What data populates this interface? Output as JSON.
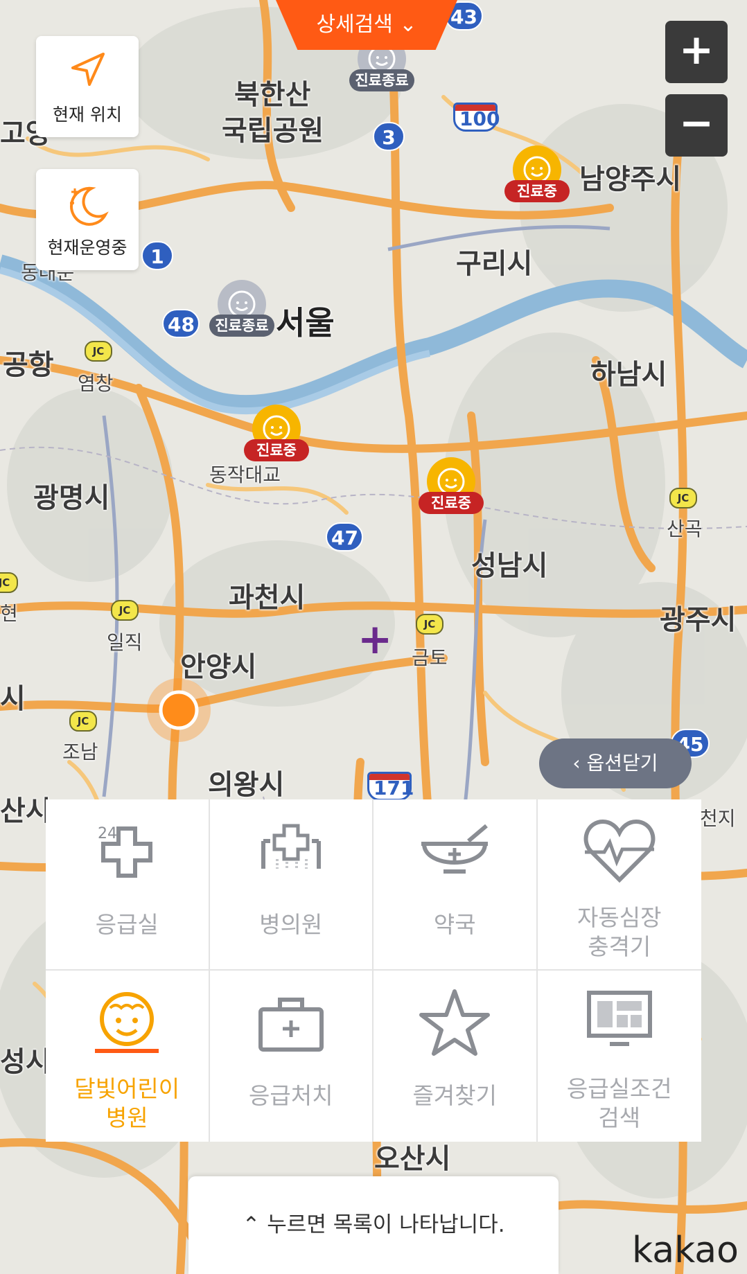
{
  "top_tab": {
    "label": "상세검색 ⌄"
  },
  "zoom": {
    "plus": "+",
    "minus": "−"
  },
  "side_buttons": [
    {
      "label": "현재 위치",
      "icon": "navigation-arrow-icon"
    },
    {
      "label": "현재운영중",
      "icon": "moon-stars-icon"
    }
  ],
  "places": [
    {
      "text": "북한산",
      "size": "md"
    },
    {
      "text": "국립공원",
      "size": "md"
    },
    {
      "text": "남양주시",
      "size": "md"
    },
    {
      "text": "구리시",
      "size": "md"
    },
    {
      "text": "서울",
      "size": "big"
    },
    {
      "text": "하남시",
      "size": "md"
    },
    {
      "text": "공항",
      "size": "md"
    },
    {
      "text": "염창",
      "size": "sm"
    },
    {
      "text": "동작대교",
      "size": "sm"
    },
    {
      "text": "광명시",
      "size": "md"
    },
    {
      "text": "산곡",
      "size": "sm"
    },
    {
      "text": "성남시",
      "size": "md"
    },
    {
      "text": "광주시",
      "size": "md"
    },
    {
      "text": "과천시",
      "size": "md"
    },
    {
      "text": "일직",
      "size": "sm"
    },
    {
      "text": "안양시",
      "size": "md"
    },
    {
      "text": "금토",
      "size": "sm"
    },
    {
      "text": "조남",
      "size": "sm"
    },
    {
      "text": "의왕시",
      "size": "md"
    },
    {
      "text": "산시",
      "size": "md"
    },
    {
      "text": "오산시",
      "size": "md"
    },
    {
      "text": "성시",
      "size": "md"
    },
    {
      "text": "동대문",
      "size": "sm"
    },
    {
      "text": "고양",
      "size": "md"
    },
    {
      "text": "시",
      "size": "md"
    },
    {
      "text": "현",
      "size": "sm"
    },
    {
      "text": "천지",
      "size": "sm"
    }
  ],
  "shields": [
    "43",
    "100",
    "3",
    "1",
    "48",
    "47",
    "45",
    "171"
  ],
  "junctions": [
    "JC",
    "JC",
    "JC",
    "JC",
    "JC",
    "JC",
    "JC"
  ],
  "markers": [
    {
      "status": "진료종료",
      "active": false
    },
    {
      "status": "진료중",
      "active": true
    },
    {
      "status": "진료종료",
      "active": false
    },
    {
      "status": "진료중",
      "active": true
    },
    {
      "status": "진료중",
      "active": true
    }
  ],
  "close_options": {
    "label": "옵션닫기"
  },
  "categories": [
    {
      "label": "응급실",
      "icon": "emergency-24-cross-icon",
      "active": false
    },
    {
      "label": "병의원",
      "icon": "hospital-building-icon",
      "active": false
    },
    {
      "label": "약국",
      "icon": "pharmacy-bowl-icon",
      "active": false
    },
    {
      "label_1": "자동심장",
      "label_2": "충격기",
      "icon": "heart-pulse-icon",
      "active": false
    },
    {
      "label_1": "달빛어린이",
      "label_2": "병원",
      "icon": "child-face-icon",
      "active": true
    },
    {
      "label": "응급처치",
      "icon": "first-aid-kit-icon",
      "active": false
    },
    {
      "label": "즐겨찾기",
      "icon": "star-icon",
      "active": false
    },
    {
      "label_1": "응급실조건",
      "label_2": "검색",
      "icon": "monitor-icon",
      "active": false
    }
  ],
  "hint": {
    "text": "누르면 목록이 나타납니다."
  },
  "brand": {
    "text": "kakao"
  },
  "colors": {
    "accent": "#ff5a14",
    "active": "#f7a300",
    "inactive": "#a7a9ae",
    "status_on": "#c62424",
    "status_off": "#5b6170"
  }
}
